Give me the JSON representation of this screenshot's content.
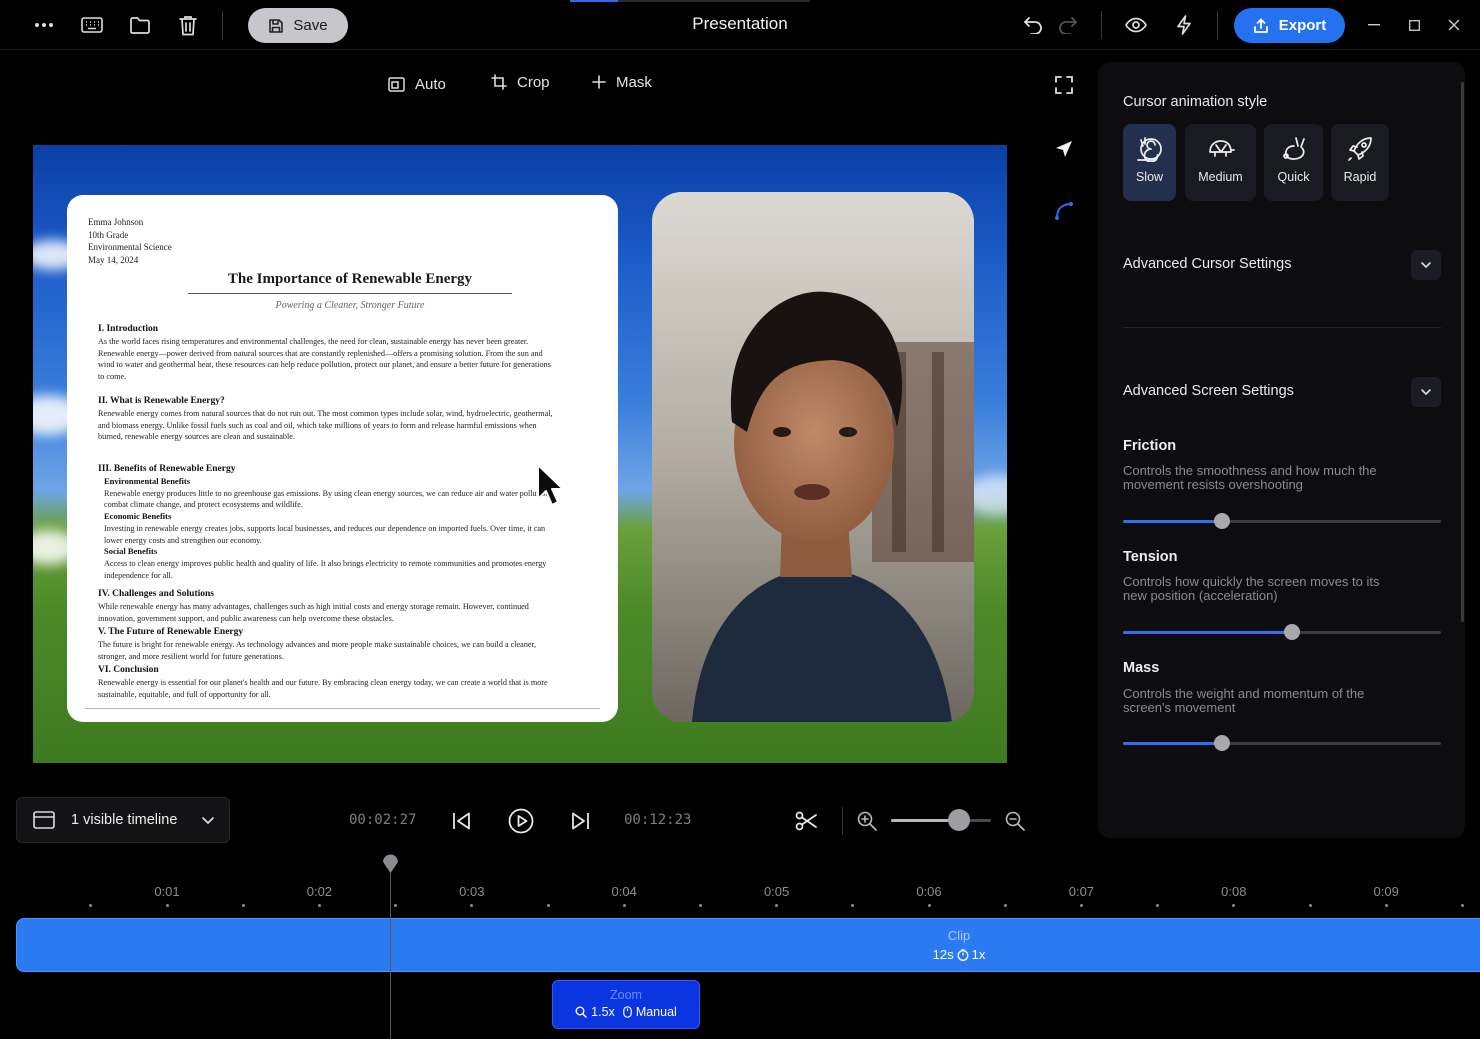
{
  "window": {
    "title": "Presentation",
    "save_label": "Save",
    "export_label": "Export"
  },
  "canvas_toolbar": {
    "auto_label": "Auto",
    "crop_label": "Crop",
    "mask_label": "Mask"
  },
  "document": {
    "meta": [
      "Emma Johnson",
      "10th Grade",
      "Environmental Science",
      "May 14, 2024"
    ],
    "title": "The Importance of Renewable Energy",
    "subtitle": "Powering a Cleaner, Stronger Future",
    "sections": [
      {
        "heading": "I. Introduction",
        "body": "As the world faces rising temperatures and environmental challenges, the need for clean, sustainable energy has never been greater. Renewable energy—power derived from natural sources that are constantly replenished—offers a promising solution. From the sun and wind to water and geothermal heat, these resources can help reduce pollution, protect our planet, and ensure a better future for generations to come."
      },
      {
        "heading": "II. What is Renewable Energy?",
        "body": "Renewable energy comes from natural sources that do not run out. The most common types include solar, wind, hydroelectric, geothermal, and biomass energy. Unlike fossil fuels such as coal and oil, which take millions of years to form and release harmful emissions when burned, renewable energy sources are clean and sustainable."
      },
      {
        "heading": "III. Benefits of Renewable Energy",
        "subs": [
          {
            "heading": "Environmental Benefits",
            "body": "Renewable energy produces little to no greenhouse gas emissions. By using clean energy sources, we can reduce air and water pollution, combat climate change, and protect ecosystems and wildlife."
          },
          {
            "heading": "Economic Benefits",
            "body": "Investing in renewable energy creates jobs, supports local businesses, and reduces our dependence on imported fuels. Over time, it can lower energy costs and strengthen our economy."
          },
          {
            "heading": "Social Benefits",
            "body": "Access to clean energy improves public health and quality of life. It also brings electricity to remote communities and promotes energy independence for all."
          }
        ]
      },
      {
        "heading": "IV. Challenges and Solutions",
        "body": "While renewable energy has many advantages, challenges such as high initial costs and energy storage remain. However, continued innovation, government support, and public awareness can help overcome these obstacles."
      },
      {
        "heading": "V. The Future of Renewable Energy",
        "body": "The future is bright for renewable energy. As technology advances and more people make sustainable choices, we can build a cleaner, stronger, and more resilient world for future generations."
      },
      {
        "heading": "VI. Conclusion",
        "body": "Renewable energy is essential for our planet's health and our future. By embracing clean energy today, we can create a world that is more sustainable, equitable, and full of opportunity for all."
      }
    ]
  },
  "panel": {
    "cursor_style_label": "Cursor animation style",
    "styles": [
      {
        "label": "Slow",
        "icon": "snail-icon",
        "active": true
      },
      {
        "label": "Medium",
        "icon": "turtle-icon",
        "active": false
      },
      {
        "label": "Quick",
        "icon": "rabbit-icon",
        "active": false
      },
      {
        "label": "Rapid",
        "icon": "rocket-icon",
        "active": false
      }
    ],
    "advanced_cursor_label": "Advanced Cursor Settings",
    "advanced_screen_label": "Advanced Screen Settings",
    "friction": {
      "label": "Friction",
      "desc": "Controls the smoothness and how much the movement resists overshooting",
      "value": 0.31
    },
    "tension": {
      "label": "Tension",
      "desc": "Controls how quickly the screen moves to its new position (acceleration)",
      "value": 0.53
    },
    "mass": {
      "label": "Mass",
      "desc": "Controls the weight and momentum of the screen's movement",
      "value": 0.31
    }
  },
  "playback": {
    "timeline_select_label": "1 visible timeline",
    "current_time": "00:02:27",
    "total_time": "00:12:23",
    "zoom_level": 0.68
  },
  "timeline": {
    "ticks": [
      "0:01",
      "0:02",
      "0:03",
      "0:04",
      "0:05",
      "0:06",
      "0:07",
      "0:08",
      "0:09"
    ],
    "clip": {
      "title": "Clip",
      "duration": "12s",
      "speed": "1x"
    },
    "zoom": {
      "title": "Zoom",
      "scale": "1.5x",
      "mode": "Manual"
    }
  },
  "colors": {
    "accent": "#2572f0",
    "clip": "#2a7af2",
    "zoom_block": "#0a35e0"
  }
}
